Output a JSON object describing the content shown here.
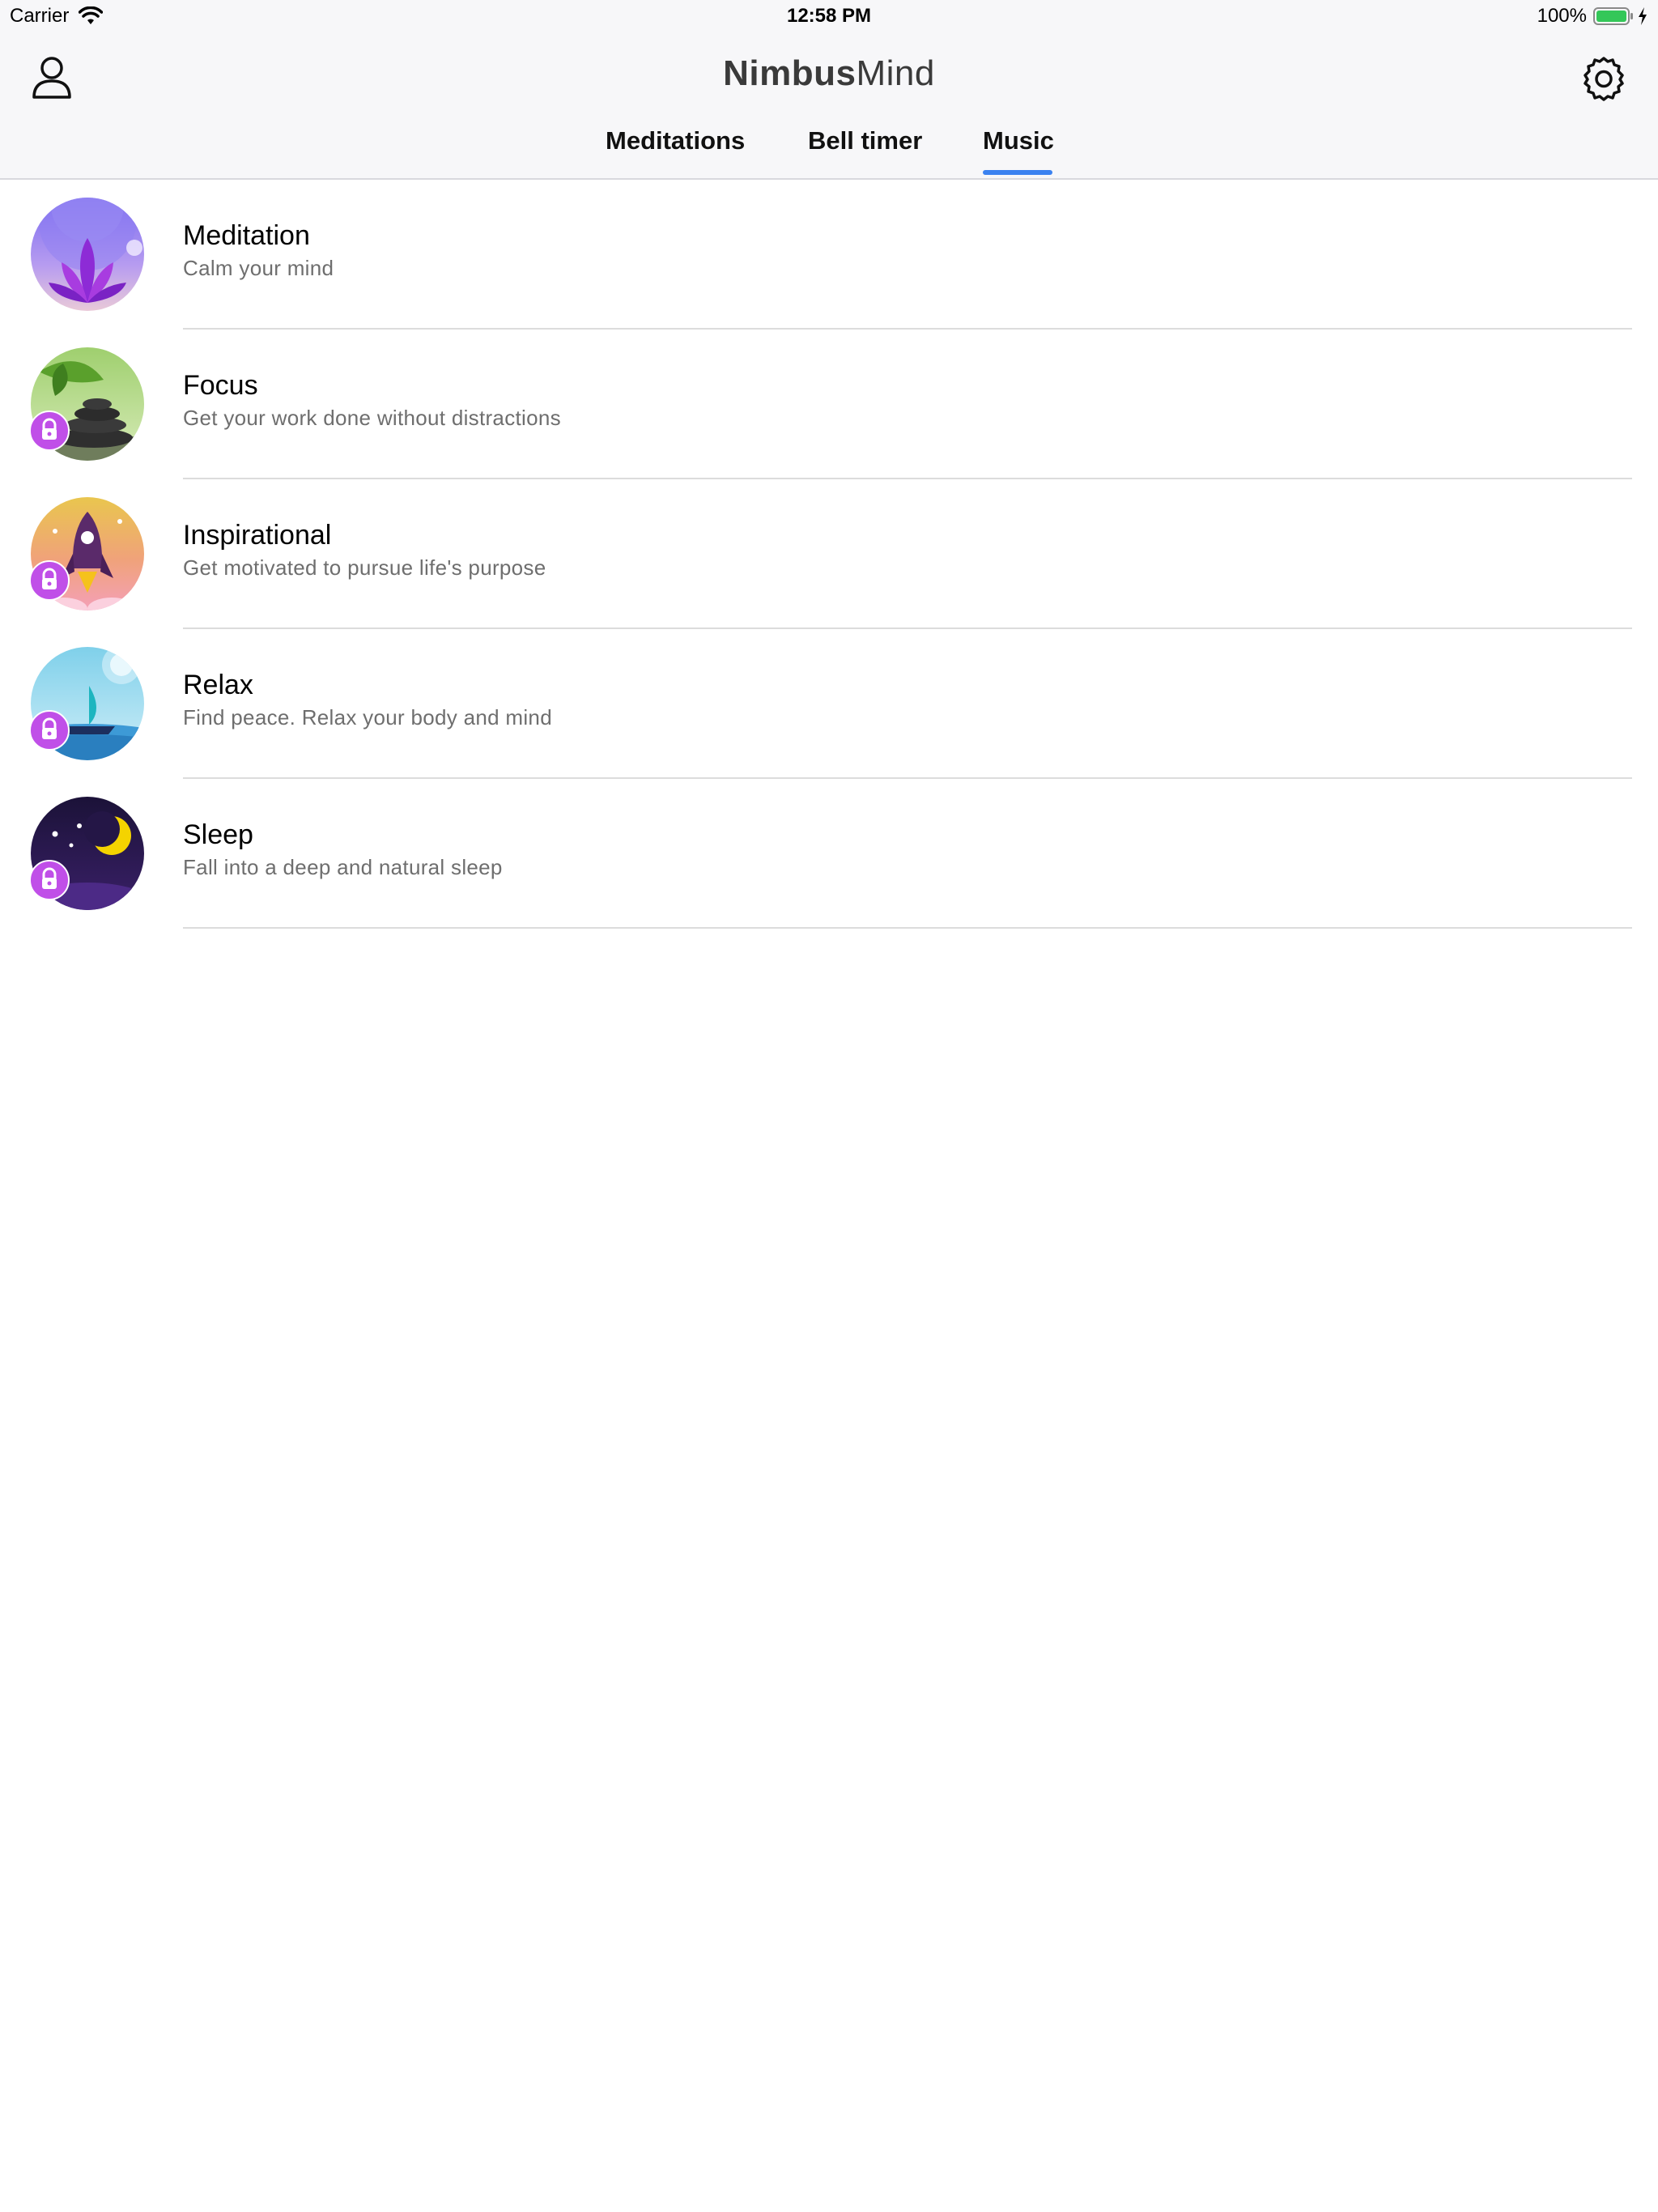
{
  "status_bar": {
    "carrier": "Carrier",
    "time": "12:58 PM",
    "battery": "100%",
    "battery_color": "#34c759"
  },
  "header": {
    "logo_part1": "Nimbus",
    "logo_part2": "Mind",
    "profile_icon": "user-outline-icon",
    "settings_icon": "gear-outline-icon"
  },
  "tabs": [
    {
      "label": "Meditations",
      "active": false
    },
    {
      "label": "Bell timer",
      "active": false
    },
    {
      "label": "Music",
      "active": true
    }
  ],
  "accent_color": "#3b82f0",
  "lock_badge_color": "#c04fe8",
  "music_categories": [
    {
      "title": "Meditation",
      "subtitle": "Calm your mind",
      "locked": false,
      "icon": "lotus-icon"
    },
    {
      "title": "Focus",
      "subtitle": "Get your work done without distractions",
      "locked": true,
      "icon": "stones-leaves-icon"
    },
    {
      "title": "Inspirational",
      "subtitle": "Get motivated to pursue life's purpose",
      "locked": true,
      "icon": "rocket-icon"
    },
    {
      "title": "Relax",
      "subtitle": "Find peace. Relax your body and mind",
      "locked": true,
      "icon": "sailboat-icon"
    },
    {
      "title": "Sleep",
      "subtitle": "Fall into a deep and natural sleep",
      "locked": true,
      "icon": "moon-stars-icon"
    }
  ]
}
